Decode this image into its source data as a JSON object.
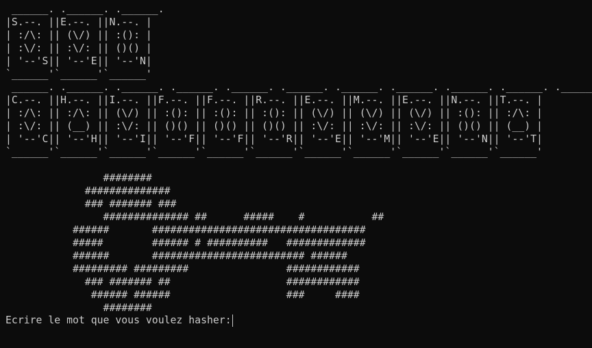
{
  "terminal": {
    "banner_top": " ______. .______. .______.\n|S.--. ||E.--. ||N.--. |\n| :/\\: || (\\/) || :(): |\n| :\\/: || :\\/: || ()() |\n| '--'S|| '--'E|| '--'N|\n`______'`______'`______'",
    "banner_bottom": " ______. .______. .______. .______. .______. .______. .______. .______. .______. .______. .______.\n|C.--. ||H.--. ||I.--. ||F.--. ||F.--. ||R.--. ||E.--. ||M.--. ||E.--. ||N.--. ||T.--. |\n| :/\\: || :/\\: || (\\/) || :(): || :(): || :(): || (\\/) || (\\/) || (\\/) || :(): || :/\\: |\n| :\\/: || (__) || :\\/: || ()() || ()() || ()() || :\\/: || :\\/: || :\\/: || ()() || (__) |\n| '--'C|| '--'H|| '--'I|| '--'F|| '--'F|| '--'R|| '--'E|| '--'M|| '--'E|| '--'N|| '--'T|\n`______'`______'`______'`______'`______'`______'`______'`______'`______'`______'`______'",
    "ascii_art": "                ########\n             ##############\n             ### ####### ###\n                ############## ##      #####    #           ##\n           ######       ###################################\n           #####        ###### # ##########   #############\n           ######       ######################### ######\n           ######### #########                ############\n             ### ####### ##                   ############\n              ###### ######                   ###     ####\n                ########",
    "prompt": "Ecrire le mot que vous voulez hasher:"
  },
  "colors": {
    "background": "#0c0c0c",
    "foreground": "#cccccc"
  }
}
